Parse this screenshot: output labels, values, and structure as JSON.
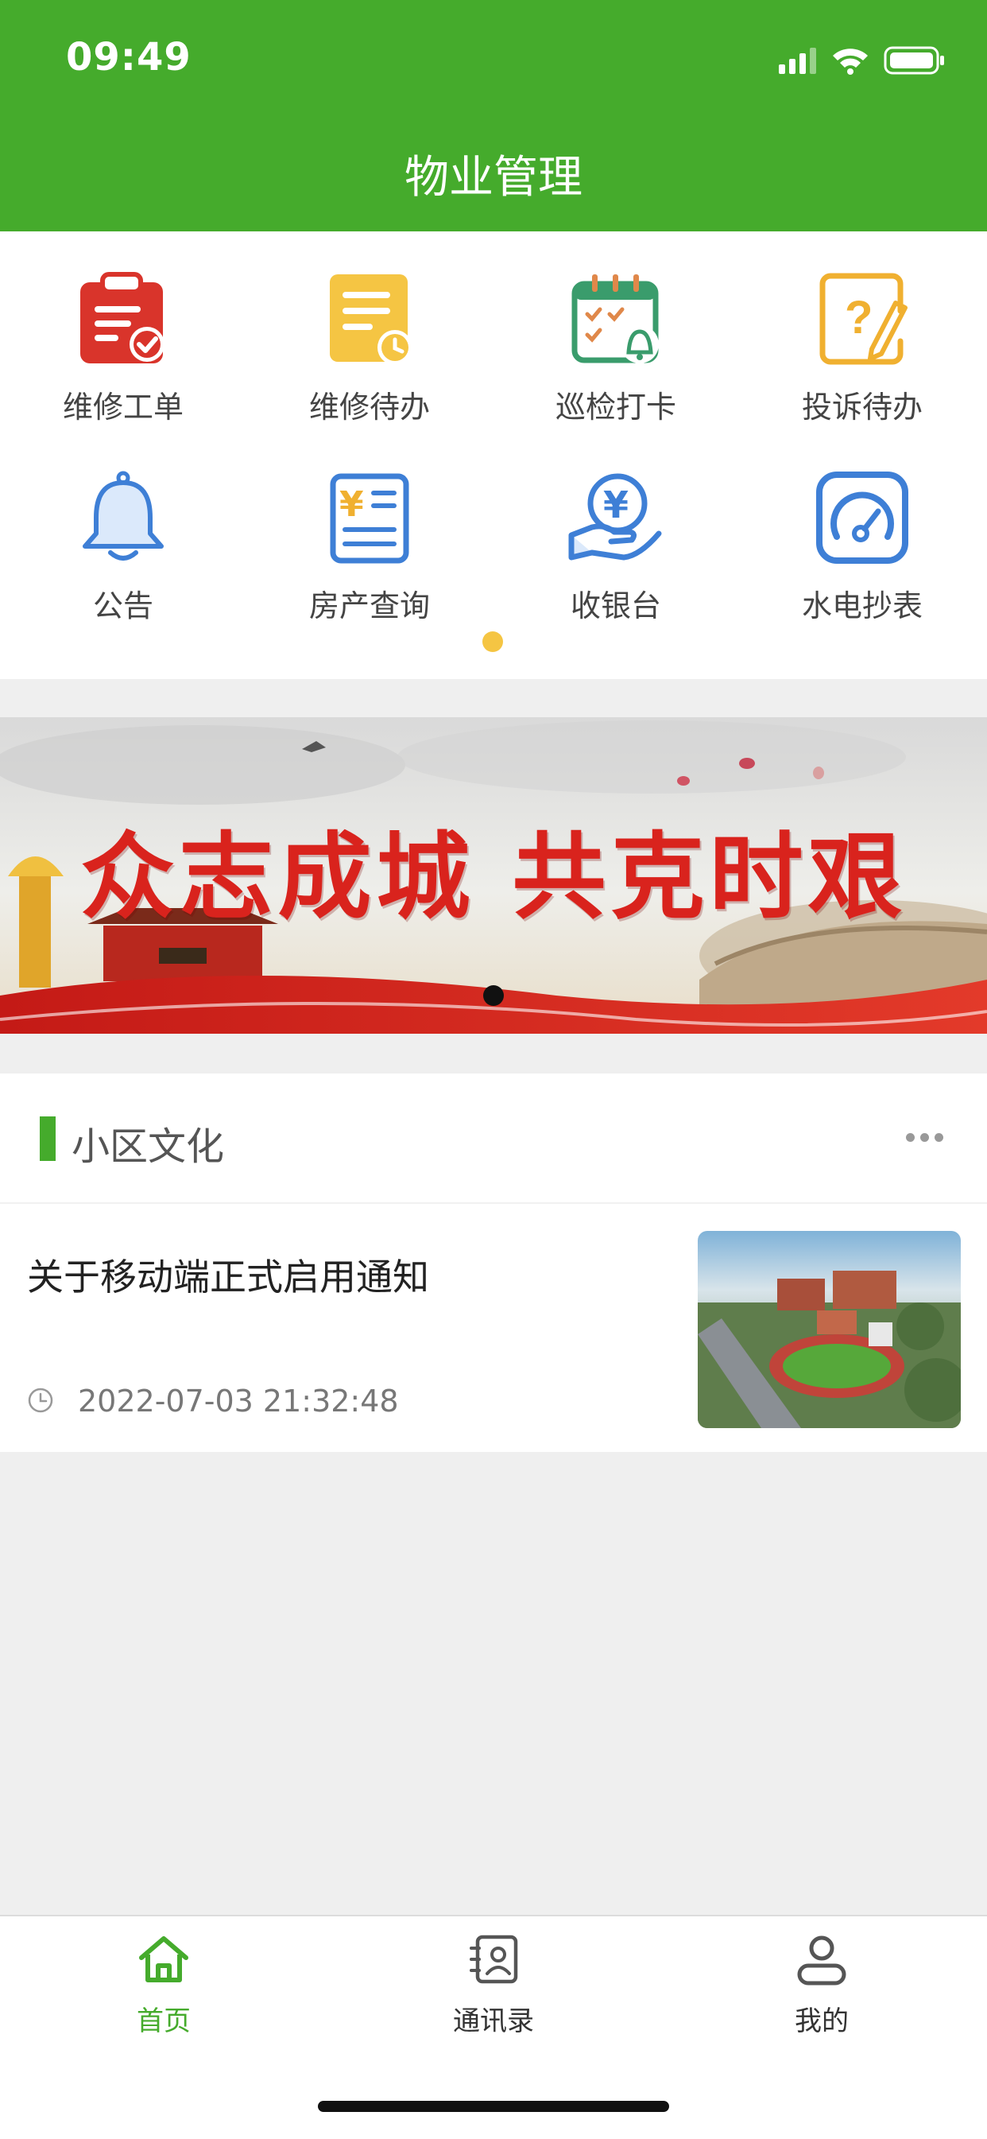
{
  "status_bar": {
    "time": "09:49"
  },
  "header": {
    "title": "物业管理"
  },
  "colors": {
    "brand": "#45ab2c",
    "active_dot": "#f5c543",
    "repair_red": "#d9342b",
    "pending_yellow": "#f5c543",
    "patrol_green": "#3a9c6c",
    "complaint_orange": "#f0b030",
    "blue": "#3e7fd6"
  },
  "functions": [
    {
      "label": "维修工单",
      "icon": "repair-order-icon"
    },
    {
      "label": "维修待办",
      "icon": "repair-todo-icon"
    },
    {
      "label": "巡检打卡",
      "icon": "patrol-checkin-icon"
    },
    {
      "label": "投诉待办",
      "icon": "complaint-todo-icon"
    },
    {
      "label": "公告",
      "icon": "bell-icon"
    },
    {
      "label": "房产查询",
      "icon": "property-query-icon"
    },
    {
      "label": "收银台",
      "icon": "cashier-icon"
    },
    {
      "label": "水电抄表",
      "icon": "meter-reading-icon"
    }
  ],
  "banner": {
    "slogan": "众志成城  共克时艰"
  },
  "section": {
    "title": "小区文化"
  },
  "news": [
    {
      "title": "关于移动端正式启用通知",
      "time": "2022-07-03 21:32:48"
    }
  ],
  "tabs": [
    {
      "label": "首页",
      "icon": "home-icon",
      "active": true
    },
    {
      "label": "通讯录",
      "icon": "contacts-icon",
      "active": false
    },
    {
      "label": "我的",
      "icon": "profile-icon",
      "active": false
    }
  ]
}
